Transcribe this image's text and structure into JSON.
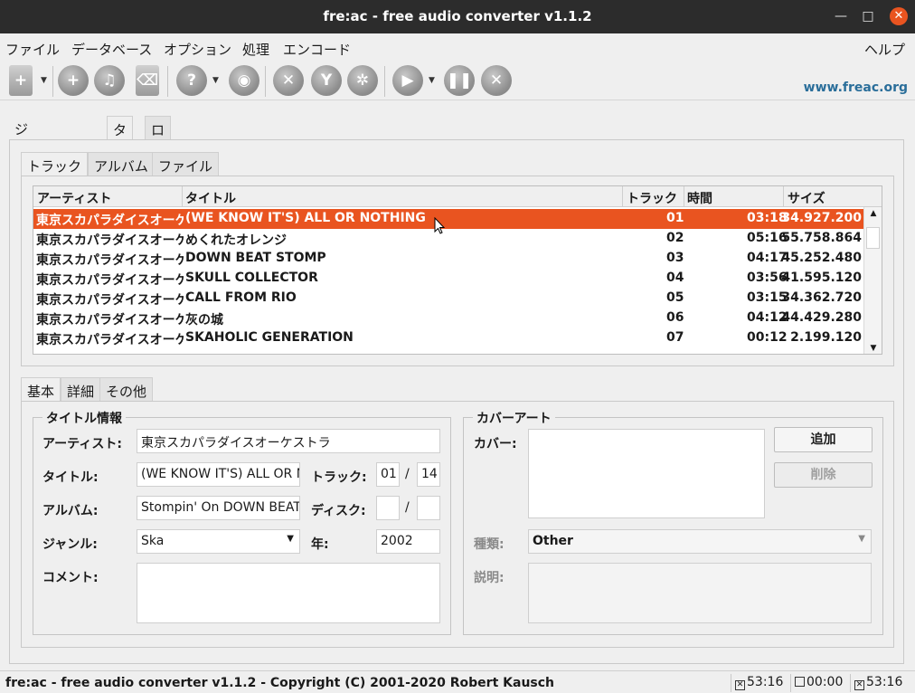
{
  "window": {
    "title": "fre:ac - free audio converter v1.1.2"
  },
  "menu": [
    "ファイル",
    "データベース",
    "オプション",
    "処理",
    "エンコード"
  ],
  "help_menu": "ヘルプ",
  "website": "www.freac.org",
  "outer_tabs": [
    "ジョブリスト",
    "タグ",
    "ログ"
  ],
  "inner_tabs": [
    "トラック",
    "アルバム",
    "ファイル"
  ],
  "columns": [
    "アーティスト",
    "タイトル",
    "トラック",
    "時間",
    "サイズ"
  ],
  "tracks": [
    {
      "artist": "東京スカパラダイスオーケストラ",
      "title": "(WE KNOW IT'S) ALL OR NOTHING",
      "track": "01",
      "time": "03:18",
      "size": "34.927.200"
    },
    {
      "artist": "東京スカパラダイスオーケストラ",
      "title": "めくれたオレンジ",
      "track": "02",
      "time": "05:16",
      "size": "55.758.864"
    },
    {
      "artist": "東京スカパラダイスオーケストラ",
      "title": "DOWN BEAT STOMP",
      "track": "03",
      "time": "04:17",
      "size": "45.252.480"
    },
    {
      "artist": "東京スカパラダイスオーケストラ",
      "title": "SKULL COLLECTOR",
      "track": "04",
      "time": "03:56",
      "size": "41.595.120"
    },
    {
      "artist": "東京スカパラダイスオーケストラ",
      "title": "CALL FROM RIO",
      "track": "05",
      "time": "03:15",
      "size": "34.362.720"
    },
    {
      "artist": "東京スカパラダイスオーケストラ",
      "title": "灰の城",
      "track": "06",
      "time": "04:12",
      "size": "44.429.280"
    },
    {
      "artist": "東京スカパラダイスオーケストラ",
      "title": "SKAHOLIC GENERATION",
      "track": "07",
      "time": "00:12",
      "size": "2.199.120"
    }
  ],
  "detail_tabs": [
    "基本",
    "詳細",
    "その他"
  ],
  "title_info": {
    "heading": "タイトル情報",
    "artist_label": "アーティスト:",
    "artist": "東京スカパラダイスオーケストラ",
    "title_label": "タイトル:",
    "title": "(WE KNOW IT'S) ALL OR NOTHING",
    "track_label": "トラック:",
    "track": "01",
    "track_total": "14",
    "album_label": "アルバム:",
    "album": "Stompin' On DOWN BEAT ALLEY",
    "disc_label": "ディスク:",
    "disc": "",
    "disc_total": "",
    "genre_label": "ジャンル:",
    "genre": "Ska",
    "year_label": "年:",
    "year": "2002",
    "comment_label": "コメント:",
    "comment": "",
    "slash": "/"
  },
  "cover_art": {
    "heading": "カバーアート",
    "cover_label": "カバー:",
    "add_button": "追加",
    "remove_button": "削除",
    "type_label": "種類:",
    "type": "Other",
    "description_label": "説明:"
  },
  "status": {
    "text": "fre:ac - free audio converter v1.1.2 - Copyright (C) 2001-2020 Robert Kausch",
    "time1": "53:16",
    "time2": "00:00",
    "time3": "53:16"
  },
  "colors": {
    "selection": "#e95420",
    "link": "#2a6e9a",
    "titlebar": "#2c2c2c"
  }
}
